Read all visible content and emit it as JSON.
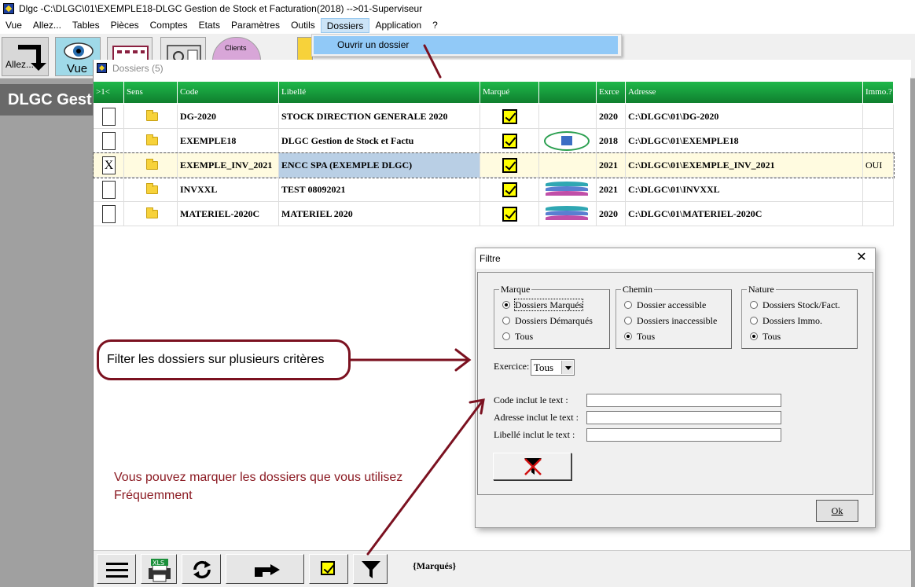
{
  "window": {
    "title": "Dlgc -C:\\DLGC\\01\\EXEMPLE18-DLGC Gestion de Stock et Facturation(2018) -->01-Superviseur"
  },
  "menubar": [
    "Vue",
    "Allez...",
    "Tables",
    "Pièces",
    "Comptes",
    "Etats",
    "Paramètres",
    "Outils",
    "Dossiers",
    "Application",
    "?"
  ],
  "menu_dropdown": {
    "open_menu": "Dossiers",
    "items": [
      "Ouvrir un dossier"
    ]
  },
  "toolbar": {
    "allez_label": "Allez...",
    "vue_label": "Vue",
    "clients_label": "Clients"
  },
  "app": {
    "header_title": "DLGC Gestion"
  },
  "dossiers_window": {
    "title": "Dossiers (5)",
    "columns": [
      ">1<",
      "Sens",
      "Code",
      "Libellé",
      "Marqué",
      "",
      "Exrce",
      "Adresse",
      "Immo.?"
    ],
    "rows": [
      {
        "checked": "",
        "code": "DG-2020",
        "libelle": "STOCK DIRECTION GENERALE 2020",
        "marque": true,
        "logo": "none",
        "exercice": "2020",
        "adresse": "C:\\DLGC\\01\\DG-2020",
        "immo": "",
        "selected": false
      },
      {
        "checked": "",
        "code": "EXEMPLE18",
        "libelle": "DLGC Gestion de Stock et Factu",
        "marque": true,
        "logo": "building-logo",
        "exercice": "2018",
        "adresse": "C:\\DLGC\\01\\EXEMPLE18",
        "immo": "",
        "selected": false
      },
      {
        "checked": "X",
        "code": "EXEMPLE_INV_2021",
        "libelle": "ENCC SPA (EXEMPLE DLGC)",
        "marque": true,
        "logo": "none",
        "exercice": "2021",
        "adresse": "C:\\DLGC\\01\\EXEMPLE_INV_2021",
        "immo": "OUI",
        "selected": true
      },
      {
        "checked": "",
        "code": "INVXXL",
        "libelle": "TEST 08092021",
        "marque": true,
        "logo": "stack-logo",
        "exercice": "2021",
        "adresse": "C:\\DLGC\\01\\INVXXL",
        "immo": "",
        "selected": false
      },
      {
        "checked": "",
        "code": "MATERIEL-2020C",
        "libelle": "MATERIEL 2020",
        "marque": true,
        "logo": "stack-logo",
        "exercice": "2020",
        "adresse": "C:\\DLGC\\01\\MATERIEL-2020C",
        "immo": "",
        "selected": false
      }
    ]
  },
  "filtre_dialog": {
    "title": "Filtre",
    "close_label": "✕",
    "groups": [
      {
        "legend": "Marque",
        "options": [
          "Dossiers Marqués",
          "Dossiers Démarqués",
          "Tous"
        ],
        "selected": 0
      },
      {
        "legend": "Chemin",
        "options": [
          "Dossier accessible",
          "Dossiers inaccessible",
          "Tous"
        ],
        "selected": 2
      },
      {
        "legend": "Nature",
        "options": [
          "Dossiers Stock/Fact.",
          "Dossiers Immo.",
          "Tous"
        ],
        "selected": 2
      }
    ],
    "exercice_label": "Exercice:",
    "exercice_value": "Tous",
    "text_filters": [
      {
        "label": "Code inclut le text :",
        "value": ""
      },
      {
        "label": "Adresse inclut le text :",
        "value": ""
      },
      {
        "label": "Libellé inclut le text :",
        "value": ""
      }
    ],
    "ok_label": "Ok"
  },
  "annotations": {
    "callout": "Filter les dossiers sur plusieurs critères",
    "note": "Vous pouvez marquer les dossiers que vous utilisez Fréquemment"
  },
  "bottom_bar": {
    "icons": [
      "menu-icon",
      "xls-print-icon",
      "refresh-icon",
      "pointing-hand-icon",
      "mark-check-icon",
      "funnel-filter-icon"
    ],
    "filter_state": "{Marqués}"
  },
  "colors": {
    "grid_header": "#1fb84a",
    "annotation": "#7b1120",
    "menu_highlight": "#91c9f7",
    "mark_yellow": "#ffff00"
  }
}
